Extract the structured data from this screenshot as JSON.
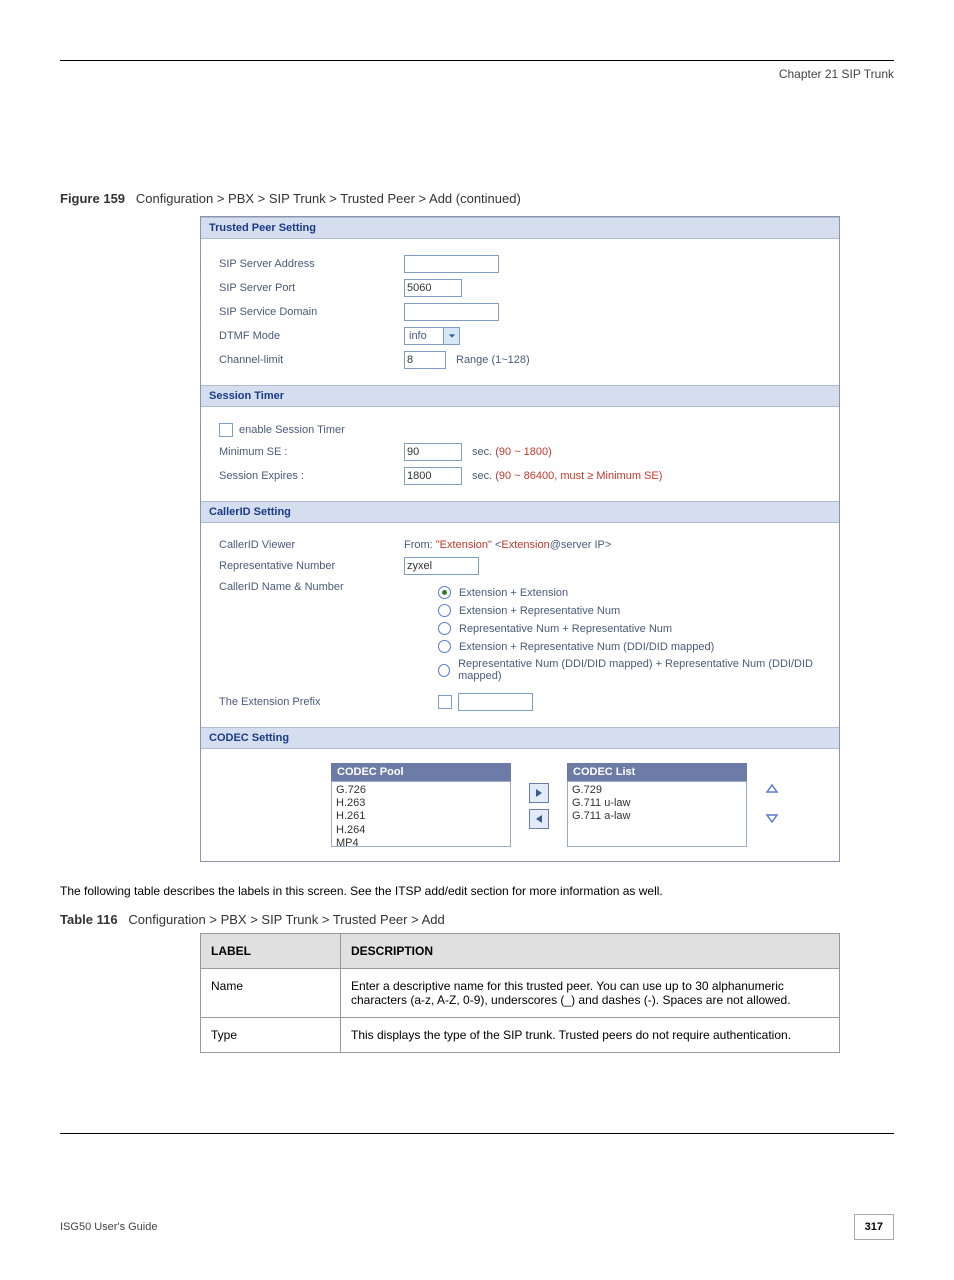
{
  "header": {
    "chapter": "Chapter 21 SIP Trunk"
  },
  "figure": {
    "label": "Figure 159",
    "title": "Configuration > PBX > SIP Trunk > Trusted Peer > Add (continued)"
  },
  "trusted_peer": {
    "title": "Trusted Peer Setting",
    "sip_server_address": {
      "label": "SIP Server Address",
      "value": ""
    },
    "sip_server_port": {
      "label": "SIP Server Port",
      "value": "5060"
    },
    "sip_service_domain": {
      "label": "SIP Service Domain",
      "value": ""
    },
    "dtmf_mode": {
      "label": "DTMF Mode",
      "value": "info"
    },
    "channel_limit": {
      "label": "Channel-limit",
      "value": "8",
      "hint": "Range (1~128)"
    }
  },
  "session_timer": {
    "title": "Session Timer",
    "enable_label": "enable Session Timer",
    "minimum_se": {
      "label": "Minimum SE :",
      "value": "90",
      "unit": "sec.",
      "range": "(90 ~ 1800)"
    },
    "session_expires": {
      "label": "Session Expires :",
      "value": "1800",
      "unit": "sec.",
      "range": "(90 ~ 86400, must ≥ Minimum SE)"
    }
  },
  "callerid": {
    "title": "CallerID Setting",
    "viewer": {
      "label": "CallerID Viewer",
      "prefix": "From: ",
      "q1": "\"Extension\"",
      "lt": " <",
      "ext_at": "Extension",
      "suffix": "@server IP>"
    },
    "rep_num": {
      "label": "Representative Number",
      "value": "zyxel"
    },
    "name_number_label": "CallerID Name & Number",
    "options": [
      "Extension + Extension",
      "Extension + Representative Num",
      "Representative Num + Representative Num",
      "Extension + Representative Num (DDI/DID mapped)",
      "Representative Num (DDI/DID mapped) + Representative Num (DDI/DID mapped)"
    ],
    "ext_prefix": {
      "label": "The Extension Prefix",
      "value": ""
    }
  },
  "codec": {
    "title": "CODEC Setting",
    "pool_label": "CODEC Pool",
    "list_label": "CODEC List",
    "pool": [
      "G.726",
      "H.263",
      "H.261",
      "H.264",
      "MP4"
    ],
    "list": [
      "G.729",
      "G.711 u-law",
      "G.711 a-law"
    ]
  },
  "description": {
    "para": "The following table describes the labels in this screen. See the ITSP add/edit section for more information as well.",
    "label": "Table 116",
    "title": "Configuration > PBX > SIP Trunk > Trusted Peer > Add",
    "col_label": "LABEL",
    "col_desc": "DESCRIPTION",
    "rows": [
      {
        "label": "Name",
        "desc": "Enter a descriptive name for this trusted peer. You can use up to 30 alphanumeric characters (a-z, A-Z, 0-9), underscores (_) and dashes (-). Spaces are not allowed."
      },
      {
        "label": "Type",
        "desc": "This displays the type of the SIP trunk. Trusted peers do not require authentication."
      }
    ]
  },
  "footer": {
    "book": "ISG50 User's Guide",
    "page": "317"
  }
}
